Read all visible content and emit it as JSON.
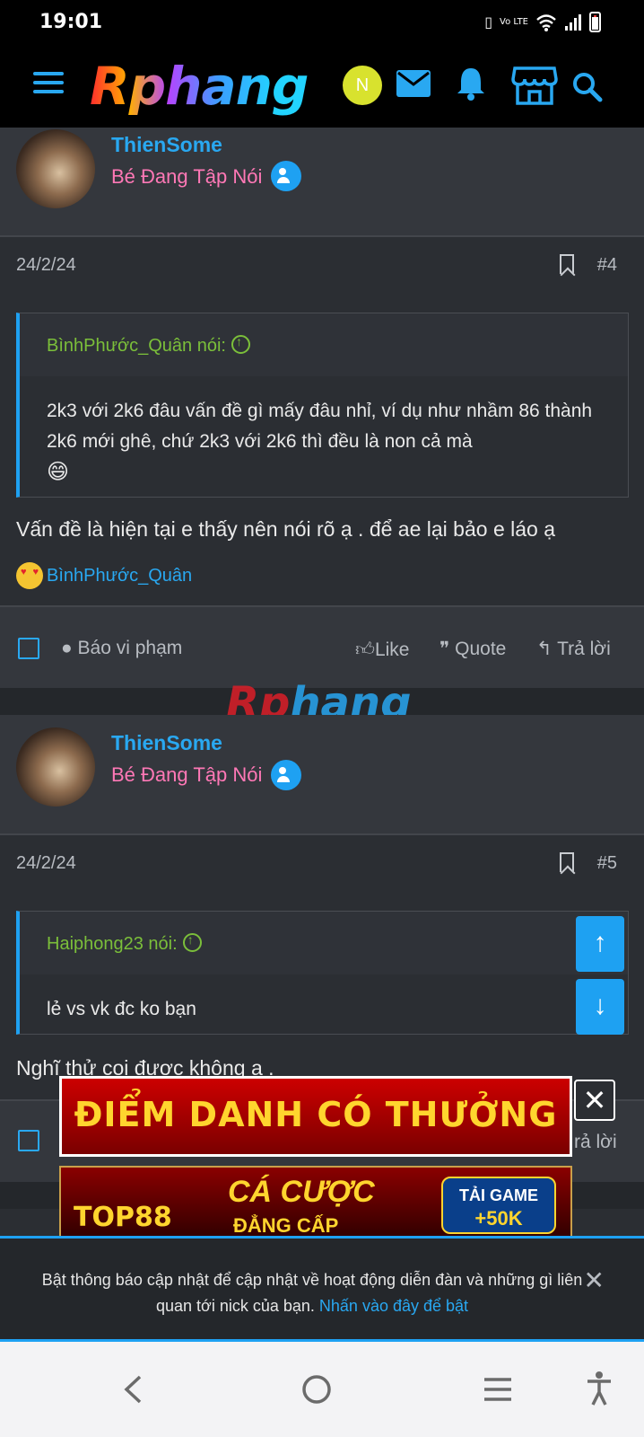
{
  "status_bar": {
    "time": "19:01",
    "network": "Vo LTE",
    "signal_label": "signal"
  },
  "header": {
    "logo": "Rphang",
    "avatar_letter": "N"
  },
  "colors": {
    "accent": "#29a8f1",
    "username": "#29a8f1",
    "usertitle": "#ff78b6",
    "quote_author": "#7bbf3a",
    "background": "#2b2e33"
  },
  "posts": [
    {
      "username": "ThienSome",
      "user_title": "Bé Đang Tập Nói",
      "date": "24/2/24",
      "number": "#4",
      "quote_author": "BìnhPhước_Quân nói:",
      "quote_text": "2k3 với 2k6 đâu vấn đề gì mấy đâu nhỉ, ví dụ như nhầm 86 thành 2k6 mới ghê, chứ 2k3 với 2k6 thì đều là non cả mà",
      "quote_emoji": "😄",
      "text": "Vấn đề là hiện tại e thấy nên nói rõ ạ . để ae lại bảo e láo ạ",
      "reaction_user": "BìnhPhước_Quân"
    },
    {
      "username": "ThienSome",
      "user_title": "Bé Đang Tập Nói",
      "date": "24/2/24",
      "number": "#5",
      "quote_author": "Haiphong23 nói:",
      "quote_text": "lẻ vs vk đc ko bạn",
      "text": "Nghĩ thử coi được không ạ ."
    }
  ],
  "actions": {
    "report": "Báo vi phạm",
    "like": "Like",
    "quote": "Quote",
    "reply": "Trả lời",
    "reply_partial": "rả lời"
  },
  "watermark": {
    "part1": "Rp",
    "part2": "hang"
  },
  "ads": {
    "banner1": "ĐIỂM DANH CÓ THƯỞNG",
    "banner2_brand": "TOP88",
    "banner2_line1": "CÁ CƯỢC",
    "banner2_line2": "ĐẲNG CẤP",
    "banner2_cta1": "TẢI GAME",
    "banner2_cta2": "+50K"
  },
  "notification": {
    "message": "Bật thông báo cập nhật để cập nhật về hoạt động diễn đàn và những gì liên quan tới nick của bạn.",
    "link": "Nhấn vào đây để bật",
    "close": "✕"
  }
}
